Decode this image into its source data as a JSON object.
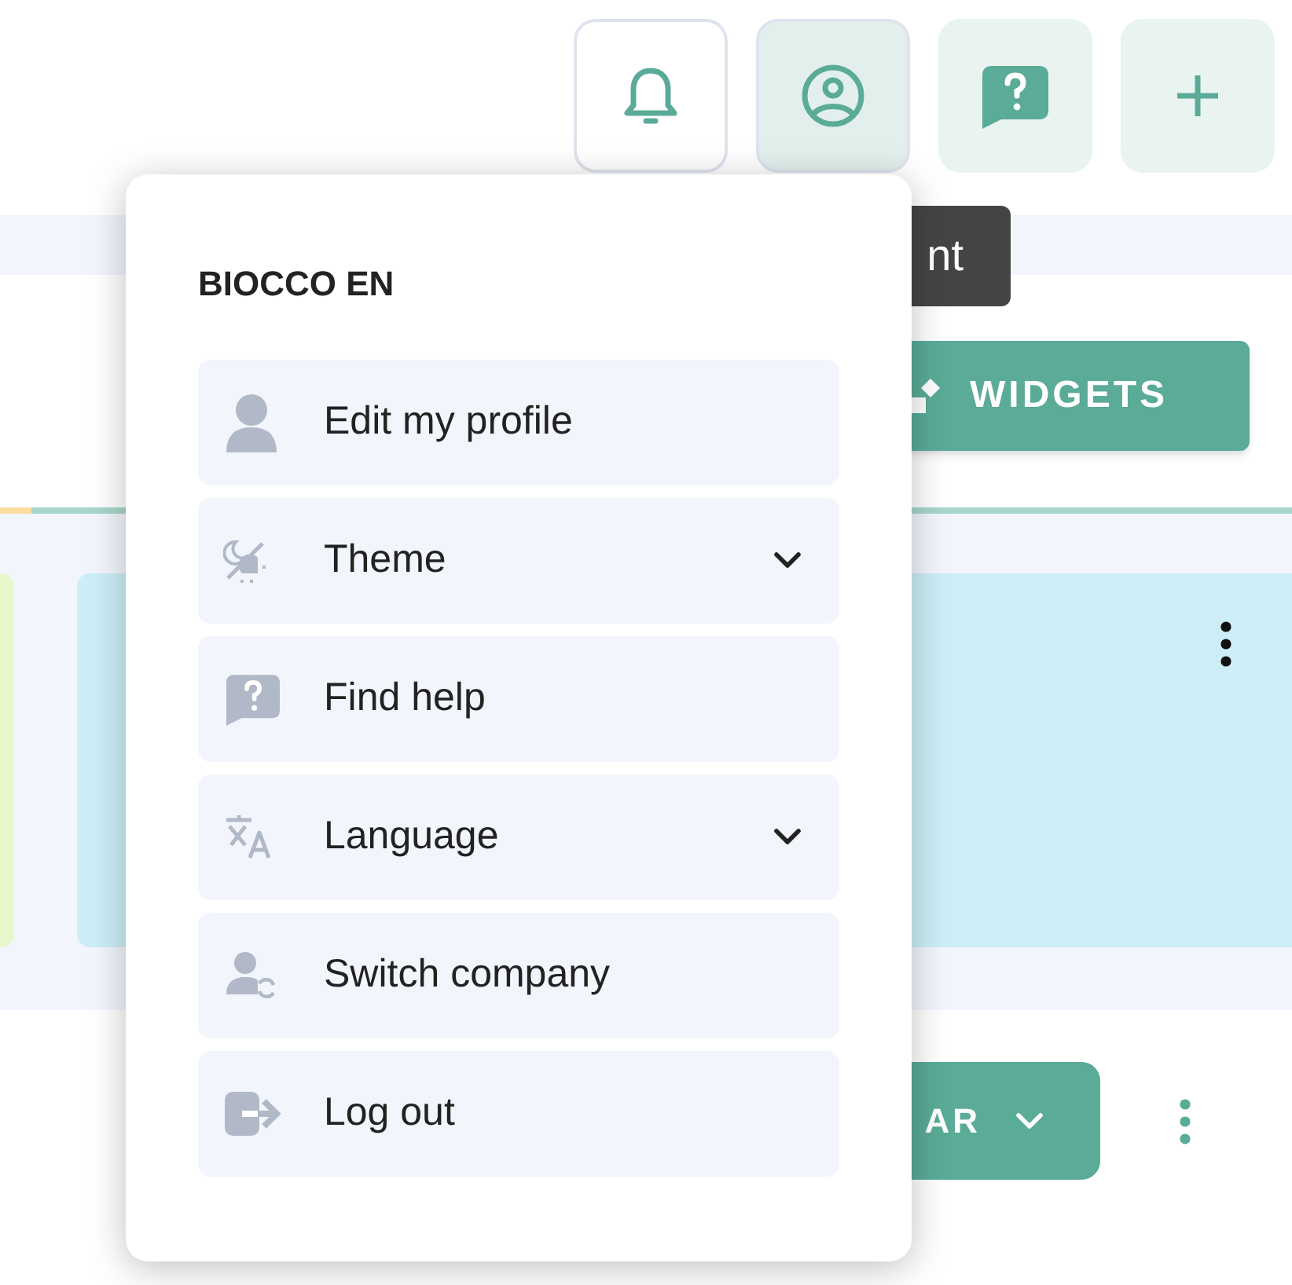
{
  "header_buttons": [
    {
      "kind": "bell",
      "selected": false
    },
    {
      "kind": "user",
      "selected": true
    },
    {
      "kind": "help",
      "selected": false
    },
    {
      "kind": "plus",
      "selected": false
    }
  ],
  "tooltip": "nt",
  "widgets_button": "WIDGETS",
  "bottom_button": "AR",
  "account_menu": {
    "title": "BIOCCO EN",
    "items": [
      {
        "kind": "profile",
        "label": "Edit my profile",
        "expandable": false
      },
      {
        "kind": "theme",
        "label": "Theme",
        "expandable": true
      },
      {
        "kind": "help",
        "label": "Find help",
        "expandable": false
      },
      {
        "kind": "language",
        "label": "Language",
        "expandable": true
      },
      {
        "kind": "switch",
        "label": "Switch company",
        "expandable": false
      },
      {
        "kind": "logout",
        "label": "Log out",
        "expandable": false
      }
    ]
  }
}
